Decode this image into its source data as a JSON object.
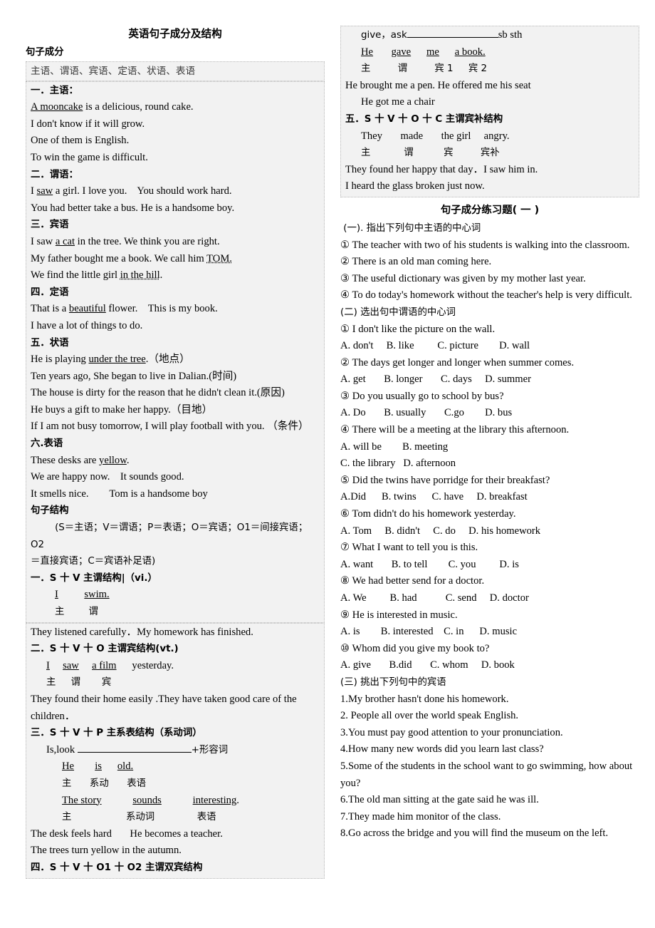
{
  "document": {
    "title": "英语句子成分及结构"
  },
  "left": {
    "section_components_heading": "句子成分",
    "components_list": "主语、谓语、宾语、定语、状语、表语",
    "subject": {
      "heading": "一．主语：",
      "lines": [
        {
          "pre": "",
          "underline": "A mooncake",
          "post": " is a delicious, round cake."
        },
        {
          "pre": "I don't know if it will grow.",
          "underline": "",
          "post": ""
        },
        {
          "pre": "One of them is English.",
          "underline": "",
          "post": ""
        },
        {
          "pre": "To win the game is difficult.",
          "underline": "",
          "post": ""
        }
      ]
    },
    "predicate": {
      "heading": "二．谓语：",
      "lines": [
        {
          "pre": "I ",
          "underline": "saw",
          "post": " a girl. I love you.    You should work hard."
        },
        {
          "pre": "You had better take a bus. He is a handsome boy.",
          "underline": "",
          "post": ""
        }
      ]
    },
    "object": {
      "heading": "三．宾语",
      "lines": [
        {
          "pre": "I saw ",
          "underline": "a cat",
          "post": " in the tree. We think you are right."
        },
        {
          "pre": "My father bought me a book. We call him ",
          "underline": "TOM.",
          "post": ""
        },
        {
          "pre": "We find the little girl ",
          "underline": "in the hill",
          "post": "."
        }
      ]
    },
    "attributive": {
      "heading": "四．定语",
      "lines": [
        {
          "pre": "That is a ",
          "underline": "beautiful",
          "post": " flower.    This is my book."
        },
        {
          "pre": "I have a lot of things to do.",
          "underline": "",
          "post": ""
        }
      ]
    },
    "adverbial": {
      "heading": "五．状语",
      "lines": [
        {
          "pre": "He is playing ",
          "underline": "under the tree",
          "post": ".（地点）"
        },
        {
          "pre": "Ten years ago, She began to live in Dalian.(时间)",
          "underline": "",
          "post": ""
        },
        {
          "pre": "The house is dirty for the reason that he didn't clean it.(原因)",
          "underline": "",
          "post": ""
        },
        {
          "pre": "He buys a gift to make her happy.（目地）",
          "underline": "",
          "post": ""
        },
        {
          "pre": "If I am not busy tomorrow, I will play football with you. （条件）",
          "underline": "",
          "post": ""
        }
      ]
    },
    "predicative": {
      "heading": "六.表语",
      "lines": [
        {
          "pre": "These desks are ",
          "underline": "yellow",
          "post": "."
        },
        {
          "pre": "We are happy now.    It sounds good.",
          "underline": "",
          "post": ""
        },
        {
          "pre": "It smells nice.        Tom is a handsome boy",
          "underline": "",
          "post": ""
        }
      ]
    },
    "structure_heading": "句子结构",
    "structure_legend_line1": "        (S＝主语；V＝谓语；P＝表语；O＝宾语；O1＝间接宾语；O2",
    "structure_legend_line2": "＝直接宾语；C＝宾语补足语)",
    "sv": {
      "heading": "一．S 十 V 主谓结构|（vi.）",
      "diagram_words": "I           swim.",
      "diagram_labels": "主        谓",
      "examples": "They listened carefully．My homework has finished."
    },
    "svo": {
      "heading": "二．S 十 V 十 O 主谓宾结构(vt.)",
      "diagram_words": "I     saw     a film      yesterday.",
      "diagram_labels": "主     谓       宾",
      "examples_line1": "They found their home easily .They have taken good care of the",
      "examples_line2": "children．"
    },
    "svp": {
      "heading": "三．S 十 V 十 P 主系表结构（系动词）",
      "formula_prefix": "Is,look ",
      "formula_suffix": "+形容词",
      "diagram1_words": "He        is      old.",
      "diagram1_labels": "主      系动      表语",
      "diagram2_words": "The story            sounds            interesting.",
      "diagram2_labels": "主                  系动词              表语",
      "examples_line1": "The desk feels hard       He becomes a teacher.",
      "examples_line2": "The trees turn yellow in the autumn."
    },
    "svoo": {
      "heading": "四．S 十 V 十 O1 十 O2 主谓双宾结构"
    }
  },
  "right": {
    "svoo_cont": {
      "formula_prefix": "give，ask",
      "formula_suffix": "sb sth",
      "diagram_words": "He       gave      me      a book.",
      "diagram_labels": "主         谓         宾 1     宾 2",
      "examples_line1": "He brought me a pen. He offered me his seat",
      "examples_line2": "He got me a chair"
    },
    "svoc": {
      "heading": "五．S 十 V 十 O 十 C 主谓宾补结构",
      "diagram_words": "They       made       the girl     angry.",
      "diagram_labels": "主           谓          宾         宾补",
      "examples_line1": "They found her happy that day．I saw him in.",
      "examples_line2": "I heard the glass broken just now."
    },
    "exercise_title": "句子成分练习题( 一 )",
    "part1": {
      "heading": " (一). 指出下列句中主语的中心词",
      "items": [
        "① The teacher with two of his students is walking into the classroom.",
        "② There is an old man coming here.",
        "③ The useful dictionary was given by my mother last year.",
        "④ To do today's homework without the teacher's help is very difficult."
      ]
    },
    "part2": {
      "heading": "(二) 选出句中谓语的中心词",
      "questions": [
        {
          "stem": "① I don't like the picture on the wall.",
          "options": "A. don't     B. like         C. picture        D. wall"
        },
        {
          "stem": "② The days get longer and longer when summer comes.",
          "options": "A. get       B. longer       C. days     D. summer"
        },
        {
          "stem": "③ Do you usually go to school by bus?",
          "options": "A. Do       B. usually       C.go        D. bus"
        },
        {
          "stem": "④ There will be a meeting at the library this afternoon.",
          "options": "A. will be        B. meeting",
          "options2": "C. the library   D. afternoon"
        },
        {
          "stem": "⑤ Did the twins have porridge for their breakfast?",
          "options": "A.Did      B. twins      C. have     D. breakfast"
        },
        {
          "stem": "⑥ Tom didn't do his homework yesterday.",
          "options": "A. Tom     B. didn't     C. do     D. his homework"
        },
        {
          "stem": "⑦ What I want to tell you is this.",
          "options": "A. want       B. to tell        C. you         D. is"
        },
        {
          "stem": "⑧ We had better send for a doctor.",
          "options": "A. We         B. had           C. send     D. doctor"
        },
        {
          "stem": "⑨ He is interested in music.",
          "options": "A. is        B. interested    C. in      D. music"
        },
        {
          "stem": "⑩ Whom did you give my book to?",
          "options": "A. give       B.did       C. whom     D. book"
        }
      ]
    },
    "part3": {
      "heading": "(三) 挑出下列句中的宾语",
      "items": [
        "1.My brother hasn't done his homework.",
        "2. People all over the world speak English.",
        "3.You must pay good attention to your pronunciation.",
        "4.How many new words did you learn last class?",
        "5.Some of the students in the school want to go swimming, how about",
        "you?",
        "6.The old man sitting at the gate said he was ill.",
        "7.They made him monitor of the class.",
        "8.Go across the bridge and you will find the museum on the left."
      ]
    }
  }
}
